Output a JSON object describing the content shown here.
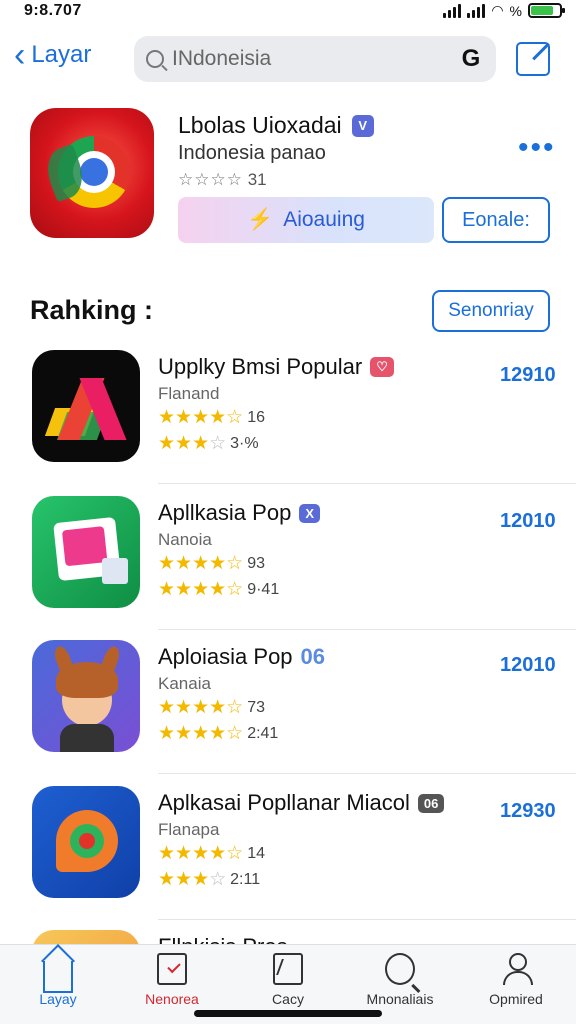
{
  "status": {
    "time": "9:8.707",
    "wifi_label": "%"
  },
  "nav": {
    "back_label": "Layar",
    "search_text": "INdoneisia",
    "search_brand": "G"
  },
  "hero": {
    "title": "Lbolas Uioxadai",
    "verified_badge": "V",
    "subtitle": "Indonesia panao",
    "stars": "☆☆☆☆",
    "rating_count": "31",
    "more": "•••",
    "primary_icon": "⚡",
    "primary_label": "Aioauing",
    "secondary_label": "Eonale:"
  },
  "ranking": {
    "title": "Rahking :",
    "button_label": "Senonriay",
    "apps": [
      {
        "name": "Upplky Bmsi Popular",
        "tag": "♡",
        "tag_color": "#e6546b",
        "category": "Flanand",
        "stars1": "★★★★",
        "half1": "☆",
        "val1": "16",
        "stars2": "★★★",
        "empty2": "☆",
        "val2": "3·%",
        "price": "12910"
      },
      {
        "name": "Apllkasia Pop",
        "tag": "X",
        "tag_color": "#5a6ad6",
        "category": "Nanoia",
        "stars1": "★★★★",
        "half1": "☆",
        "val1": "93",
        "stars2": "★★★★",
        "empty2": "☆",
        "val2": "9·41",
        "price": "12010"
      },
      {
        "name": "Aploiasia Pop",
        "tag": "06",
        "tag_color": "#5a8be0",
        "category": "Kanaia",
        "stars1": "★★★★",
        "half1": "☆",
        "val1": "73",
        "stars2": "★★★★",
        "empty2": "☆",
        "val2": "2:41",
        "price": "12010"
      },
      {
        "name": "Aplkasai Popllanar Miacol",
        "tag": "06",
        "tag_color": "#555555",
        "category": "Flanapa",
        "stars1": "★★★★",
        "half1": "☆",
        "val1": "14",
        "stars2": "★★★",
        "empty2": "☆",
        "val2": "2:11",
        "price": "12930"
      },
      {
        "name": "Fllnkisis Pros",
        "tag": "",
        "tag_color": "#5a6ad6",
        "category": "",
        "stars1": "",
        "half1": "",
        "val1": "",
        "stars2": "",
        "empty2": "",
        "val2": "",
        "price": ""
      }
    ]
  },
  "tabs": [
    {
      "label": "Layay"
    },
    {
      "label": "Nenorea"
    },
    {
      "label": "Cacy"
    },
    {
      "label": "Mnonaliais"
    },
    {
      "label": "Opmired"
    }
  ],
  "colors": {
    "accent": "#1b6fd9",
    "star": "#f2b900",
    "active_red": "#d3282f"
  }
}
